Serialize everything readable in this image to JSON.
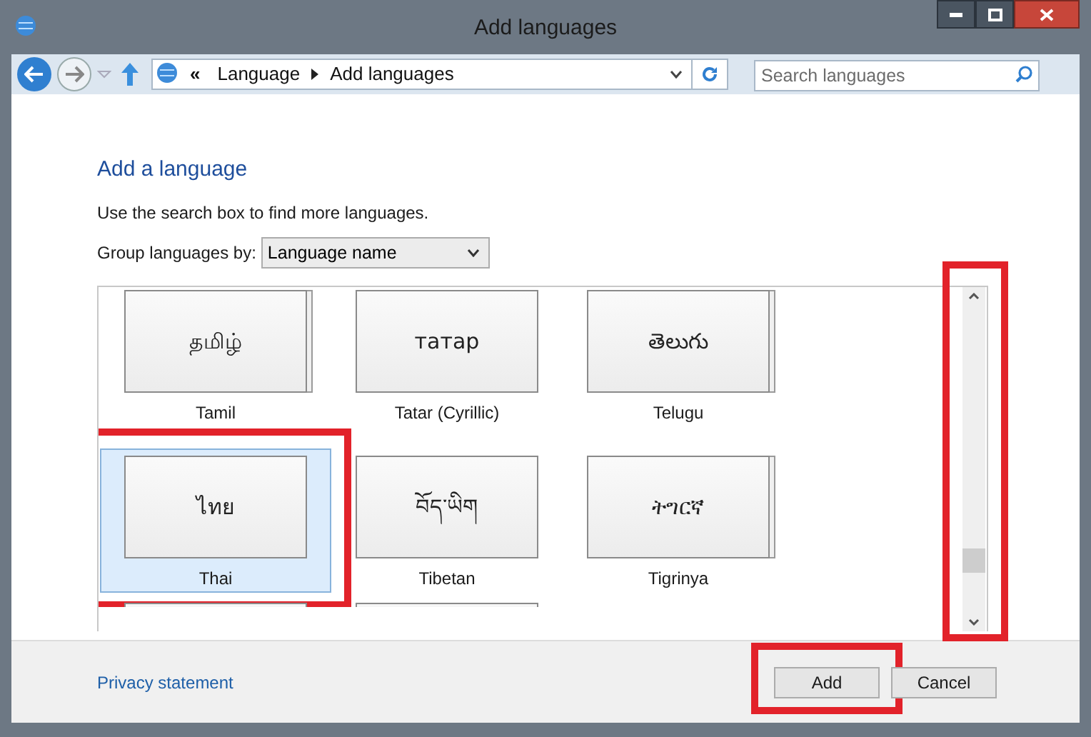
{
  "window": {
    "title": "Add languages"
  },
  "address_bar": {
    "overflow": "«",
    "crumbs": [
      "Language",
      "Add languages"
    ]
  },
  "search": {
    "placeholder": "Search languages"
  },
  "heading": "Add a language",
  "hint": "Use the search box to find more languages.",
  "group_by": {
    "label": "Group languages by:",
    "value": "Language name"
  },
  "languages": [
    {
      "kind": "tile",
      "native": "தமிழ்",
      "name": "Tamil",
      "selected": false,
      "stacked": true,
      "annotated": false
    },
    {
      "kind": "tile",
      "native": "татар",
      "name": "Tatar (Cyrillic)",
      "selected": false,
      "stacked": false,
      "annotated": false
    },
    {
      "kind": "tile",
      "native": "తెలుగు",
      "name": "Telugu",
      "selected": false,
      "stacked": true,
      "annotated": false
    },
    {
      "kind": "tile",
      "native": "ไทย",
      "name": "Thai",
      "selected": true,
      "stacked": false,
      "annotated": true
    },
    {
      "kind": "tile",
      "native": "བོད་ཡིག",
      "name": "Tibetan",
      "selected": false,
      "stacked": false,
      "annotated": false
    },
    {
      "kind": "tile",
      "native": "ትግርኛ",
      "name": "Tigrinya",
      "selected": false,
      "stacked": true,
      "annotated": false
    },
    {
      "kind": "partial"
    },
    {
      "kind": "partial"
    }
  ],
  "scrollbar": {
    "annotated": true
  },
  "footer": {
    "link": "Privacy statement",
    "buttons": [
      {
        "label": "Add",
        "annotated": true
      },
      {
        "label": "Cancel",
        "annotated": false
      }
    ]
  }
}
